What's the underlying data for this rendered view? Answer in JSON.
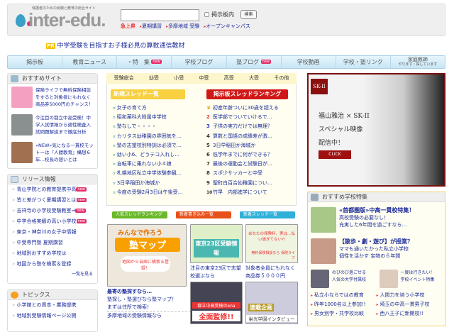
{
  "header": {
    "tagline": "保護者のための受験と教育の総合サイト",
    "logo": "inter-edu.",
    "search_placeholder": "",
    "checkbox_label": "掲示板内",
    "search_button": "検索",
    "up_label": "急上昇",
    "quick_links": [
      "夏期講習",
      "多摩地域 受験",
      "オープンキャンパス"
    ]
  },
  "pr": {
    "badge": "PR",
    "text": "中学受験を目指すお子様必見の算数通信教材"
  },
  "nav": {
    "items": [
      {
        "label": "掲示板"
      },
      {
        "label": "教育ニュース"
      },
      {
        "label": "・特　集",
        "badge": "new"
      },
      {
        "label": "学校ブログ"
      },
      {
        "label": "塾ブログ",
        "badge": "new"
      },
      {
        "label": "学校動画"
      },
      {
        "label": "学校・塾リンク"
      },
      {
        "label": "家庭教師",
        "sub": "やります・探しています"
      }
    ]
  },
  "recommend": {
    "title": "おすすめサイト",
    "items": [
      "保険ライフで無料保険相談をすると対象者にもれなく商品券5000円のチャンス！",
      "今注目の都立中高受検！中学入試情報から適性検査入試問題解説まで徹底分析",
      "«NEW»気になる一貫校モットーは『人間教育』構想６年…校長の想いとは"
    ]
  },
  "release": {
    "title": "リリース情報",
    "items": [
      {
        "text": "青山学院との教育提携中高",
        "new": true
      },
      {
        "text": "皆と差がつく夏期講習とは",
        "new": true
      },
      {
        "text": "吉祥寺の小学校受験教室⇒",
        "new": true
      },
      {
        "text": "中学合格実績の高い小学校",
        "new": true
      },
      {
        "text": "東京・神奈川の女子中情報"
      },
      {
        "text": "中受専門塾 夏期講習"
      },
      {
        "text": "地域別おすすめ学校は"
      },
      {
        "text": "地図から塾を検索＆登録"
      }
    ],
    "more": "一覧を見る",
    "new_label": "new"
  },
  "topics": {
    "title": "トピックス",
    "items": [
      "小学館との資本・業務提携",
      "地域別受験情報ページ公開"
    ]
  },
  "center": {
    "tabs": [
      "受験総合",
      "幼受",
      "小受",
      "中受",
      "高受",
      "大受",
      "その他"
    ],
    "new_threads_title": "新規スレッド一覧",
    "new_threads": [
      "女子の育て方",
      "昭和薬科大附属中学校",
      "塾なしで・・・・",
      "カリタス幼稚園の雰囲気を...",
      "塾の志望校別特訓は必須で...",
      "幼い小6、どうテコ入れし...",
      "自転車に乗れない小４娘",
      "札幌地区私立中学体験参観...",
      "3日早稲田か海城か",
      "今度の受験2月3日は午後受..."
    ],
    "ranking_title": "掲示板スレッドランキング",
    "ranking": [
      "初産年齢ついに30歳を超える",
      "医学部でついていけるで...",
      "子供の実力だけでは無理？",
      "算数と国語の成績差が激...",
      "3日早稲田か海城か",
      "低学年までに何ができる？",
      "最後の運動会と試験日が...",
      "スポ少サッカーと中受",
      "聖町白百合幼稚園につい...",
      "竹早　内部進学について"
    ],
    "buttons": [
      "人気スレッドランキング",
      "新着書き込み一覧",
      "新着スレッド一覧"
    ],
    "banners": {
      "map": {
        "headline": "みんなで作ろう",
        "title": "塾マップ",
        "bubble": "地図から自由に検索＆登録！",
        "caption": [
          "最寄の塾探すなら…",
          "塾探し・塾選びなら塾マップ！",
          "まずは住所で検索！"
        ],
        "link": "多摩地域の受験情報なら"
      },
      "tokyo": {
        "title": "東京23区受験情報",
        "caption": "注目の東京23区で志望校選ぶなら"
      },
      "hoken": {
        "top": "あなたの保険料、実は…払い過ぎてない?!",
        "bottom": "無料保険相談なら 保険ライフ",
        "caption": "対象者全員にもれなく商品券５０００円"
      },
      "ena": {
        "top": "都立中高受検のena",
        "main": "全面監修!!"
      },
      "interview": {
        "badge": "連載企画",
        "text": "栄光学園インタビュー"
      }
    }
  },
  "ad": {
    "brand": "SK-II",
    "lines": [
      "福山雅治 × SK-II",
      "スペシャル映像",
      "配信中！"
    ],
    "button": "CLICK"
  },
  "school": {
    "title": "おすすめ学校特集",
    "features": [
      {
        "title": "«首都圏版»中高一貫校特集！",
        "text": [
          "高校受験の必要なし！",
          "充実した6年間を過ごすなら…"
        ],
        "thumb": "首都圏注目の中高一貫校"
      },
      {
        "title": "【散歩・劇・遊び】が授業？",
        "text": [
          "ママも通いたかった私立小学校",
          "個性を活かす 宝物の６年間"
        ]
      }
    ],
    "small": [
      [
        "のびのび過ごせる",
        "人気の大学付属校"
      ],
      [
        "一度は行きたい！",
        "学校イベント特集"
      ]
    ],
    "links": [
      "私立小ならではの教育",
      "人間力を培う小学校",
      "昨年1000名以上参加!!",
      "埼玉の中高一貫男子校",
      "男女別学・共学校比較",
      "西八王子に新開校!!"
    ]
  }
}
